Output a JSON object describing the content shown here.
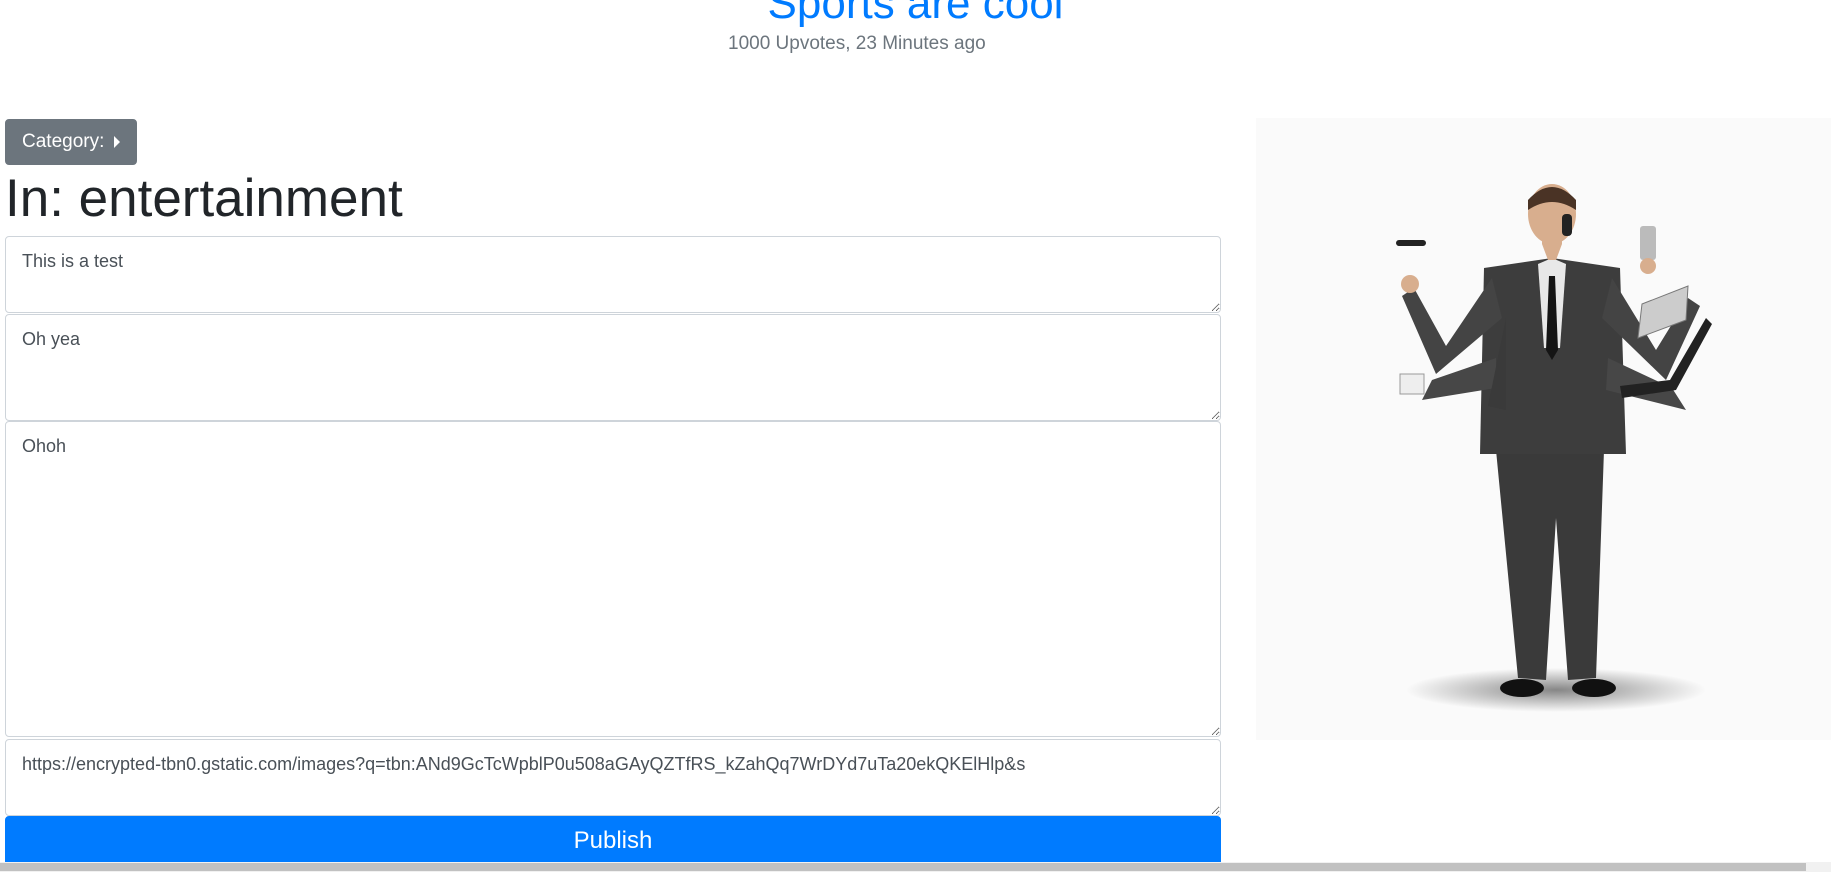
{
  "post": {
    "title": "Sports are cool",
    "meta": "1000 Upvotes, 23 Minutes ago"
  },
  "category": {
    "button_label": "Category:",
    "heading": "In: entertainment"
  },
  "fields": {
    "title_value": "This is a test",
    "summary_value": "Oh yea",
    "body_value": "Ohoh",
    "image_url_value": "https://encrypted-tbn0.gstatic.com/images?q=tbn:ANd9GcTcWpblP0u508aGAyQZTfRS_kZahQq7WrDYd7uTa20ekQKElHlp&s"
  },
  "actions": {
    "publish_label": "Publish"
  },
  "icons": {
    "category_caret": "caret-right-icon"
  },
  "colors": {
    "accent": "#007bff",
    "secondary": "#6c757d"
  }
}
